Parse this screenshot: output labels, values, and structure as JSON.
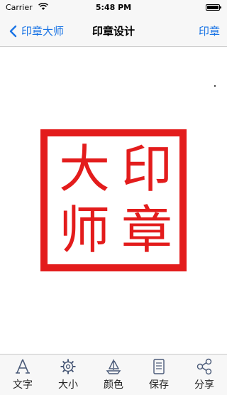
{
  "status_bar": {
    "carrier": "Carrier",
    "time": "5:48 PM"
  },
  "nav": {
    "back_label": "印章大师",
    "title": "印章设计",
    "right_label": "印章"
  },
  "seal": {
    "color": "#e31c1c",
    "chars": {
      "top_right": "印",
      "bottom_right": "章",
      "top_left": "大",
      "bottom_left": "师"
    }
  },
  "tabs": [
    {
      "label": "文字",
      "icon": "text-icon"
    },
    {
      "label": "大小",
      "icon": "gear-icon"
    },
    {
      "label": "颜色",
      "icon": "sailboat-icon"
    },
    {
      "label": "保存",
      "icon": "document-icon"
    },
    {
      "label": "分享",
      "icon": "share-icon"
    }
  ],
  "colors": {
    "accent": "#1a74e5",
    "seal": "#e31c1c"
  }
}
